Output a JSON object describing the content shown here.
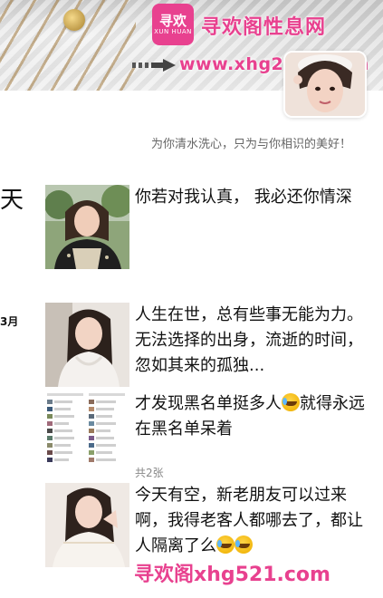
{
  "watermark": {
    "logo_char": "寻欢",
    "logo_sub": "XUN HUAN",
    "title": "寻欢阁性息网",
    "url": "www.xhg2019.com",
    "bottom": "寻欢阁xhg521.com"
  },
  "profile": {
    "signature": "为你清水洗心，只为与你相识的美好！"
  },
  "feed": {
    "day_label": "天",
    "month_label": "3月",
    "posts": [
      {
        "text": "你若对我认真，  我必还你情深"
      },
      {
        "text": "人生在世，总有些事无能为力。无法选择的出身，流逝的时间，忽如其来的孤独..."
      },
      {
        "text_a": "才发现黑名单挺多人",
        "text_b": "就得永远在黑名单呆着",
        "photo_count": "共2张"
      },
      {
        "text": "今天有空，新老朋友可以过来啊，我得老客人都哪去了，都让人隔离了么"
      }
    ]
  },
  "colors": {
    "accent": "#e8418f",
    "text": "#111111",
    "muted": "#666666"
  }
}
